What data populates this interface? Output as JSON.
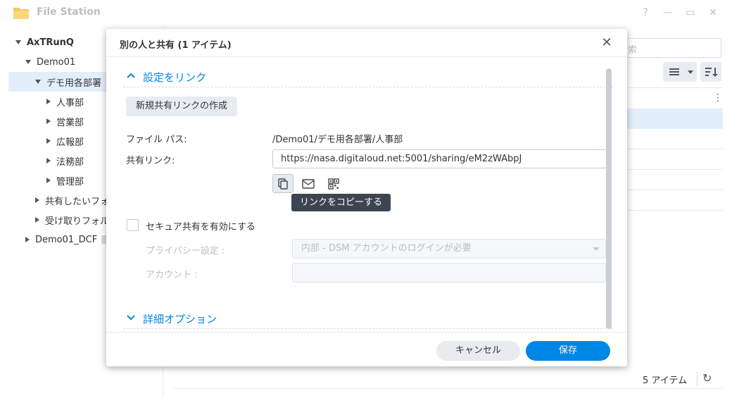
{
  "window": {
    "title": "File Station",
    "controls": {
      "help": "?",
      "minimize": "—",
      "maximize": "▭",
      "close": "✕"
    }
  },
  "sidebar": {
    "root": "AxTRunQ",
    "items": [
      {
        "label": "Demo01"
      },
      {
        "label": "デモ用各部署"
      },
      {
        "label": "人事部"
      },
      {
        "label": "営業部"
      },
      {
        "label": "広報部"
      },
      {
        "label": "法務部"
      },
      {
        "label": "管理部"
      },
      {
        "label": "共有したいフォ"
      },
      {
        "label": "受け取りフォル"
      },
      {
        "label": "Demo01_DCF"
      }
    ]
  },
  "background": {
    "search_placeholder": "索",
    "more_icon": "⋮",
    "item_count": "5 アイテム",
    "refresh_icon": "↻"
  },
  "dialog": {
    "title": "別の人と共有 (1 アイテム)",
    "close": "✕",
    "section_link": {
      "chevron": "∧",
      "label": "設定をリンク"
    },
    "create_link_button": "新規共有リンクの作成",
    "file_path_label": "ファイル パス:",
    "file_path_value": "/Demo01/デモ用各部署/人事部",
    "share_link_label": "共有リンク:",
    "share_link_value": "https://nasa.digitaloud.net:5001/sharing/eM2zWAbpJ",
    "tooltip": "リンクをコピーする",
    "secure_share_label": "セキュア共有を有効にする",
    "privacy_label": "プライバシー設定 :",
    "privacy_value": "内部 - DSM アカウントのログインが必要",
    "account_label": "アカウント :",
    "section_advanced": {
      "chevron": "∨",
      "label": "詳細オプション"
    },
    "cancel_button": "キャンセル",
    "save_button": "保存"
  },
  "colors": {
    "accent": "#0086e5",
    "selected_row": "#e2effb",
    "disabled_text": "#b9bfc6"
  }
}
